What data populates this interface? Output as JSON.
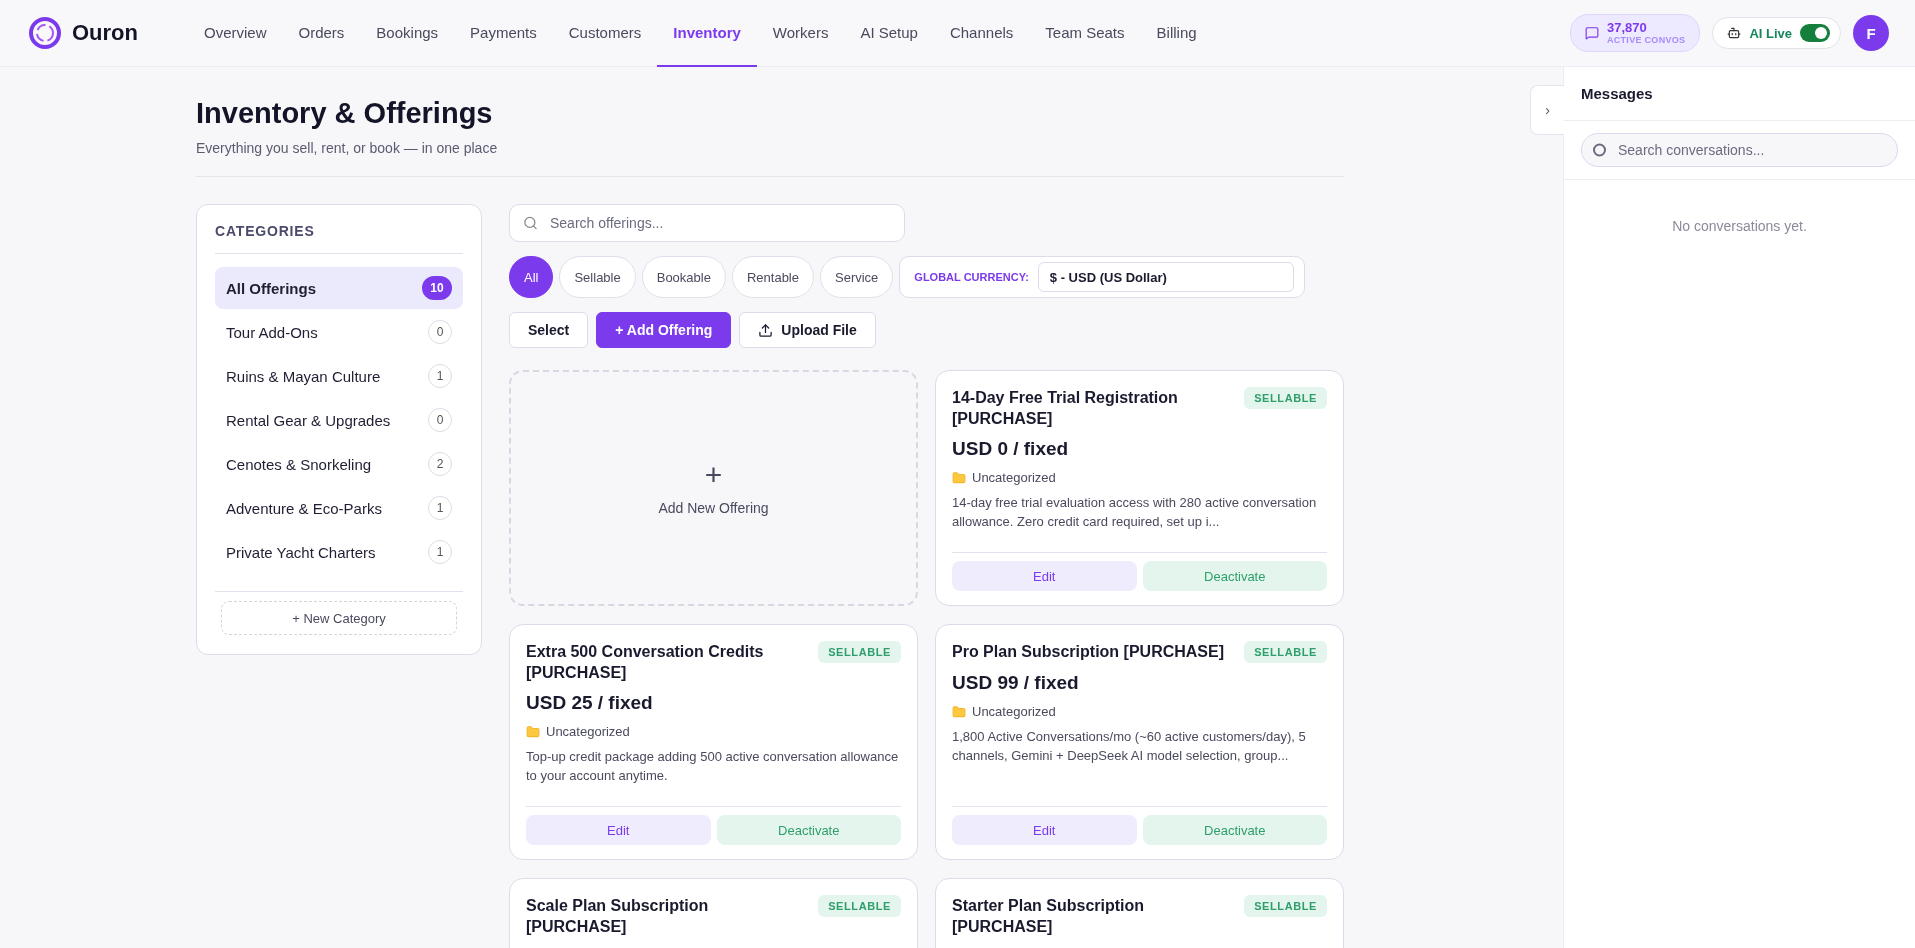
{
  "brand": {
    "name": "Ouron"
  },
  "nav": [
    {
      "label": "Overview",
      "selected": false
    },
    {
      "label": "Orders",
      "selected": false
    },
    {
      "label": "Bookings",
      "selected": false
    },
    {
      "label": "Payments",
      "selected": false
    },
    {
      "label": "Customers",
      "selected": false
    },
    {
      "label": "Inventory",
      "selected": true
    },
    {
      "label": "Workers",
      "selected": false
    },
    {
      "label": "AI Setup",
      "selected": false
    },
    {
      "label": "Channels",
      "selected": false
    },
    {
      "label": "Team Seats",
      "selected": false
    },
    {
      "label": "Billing",
      "selected": false
    }
  ],
  "convos": {
    "count": "37,870",
    "label": "ACTIVE CONVOS"
  },
  "ai_live": {
    "label": "AI Live",
    "on": true
  },
  "avatar": {
    "initial": "F"
  },
  "page": {
    "title": "Inventory & Offerings",
    "subtitle": "Everything you sell, rent, or book — in one place"
  },
  "categories": {
    "heading": "CATEGORIES",
    "items": [
      {
        "label": "All Offerings",
        "count": "10",
        "selected": true
      },
      {
        "label": "Tour Add-Ons",
        "count": "0",
        "selected": false
      },
      {
        "label": "Ruins & Mayan Culture",
        "count": "1",
        "selected": false
      },
      {
        "label": "Rental Gear & Upgrades",
        "count": "0",
        "selected": false
      },
      {
        "label": "Cenotes & Snorkeling",
        "count": "2",
        "selected": false
      },
      {
        "label": "Adventure & Eco-Parks",
        "count": "1",
        "selected": false
      },
      {
        "label": "Private Yacht Charters",
        "count": "1",
        "selected": false
      }
    ],
    "new_button": "+ New Category"
  },
  "search": {
    "placeholder": "Search offerings..."
  },
  "filters": [
    {
      "label": "All",
      "selected": true
    },
    {
      "label": "Sellable",
      "selected": false
    },
    {
      "label": "Bookable",
      "selected": false
    },
    {
      "label": "Rentable",
      "selected": false
    },
    {
      "label": "Service",
      "selected": false
    }
  ],
  "currency": {
    "label": "GLOBAL CURRENCY:",
    "value": "$ - USD (US Dollar)"
  },
  "actions": [
    {
      "label": "Select",
      "kind": "plain"
    },
    {
      "label": "+ Add Offering",
      "kind": "primary"
    },
    {
      "label": "Upload File",
      "kind": "upload"
    }
  ],
  "add_tile": {
    "label": "Add New Offering",
    "icon": "+"
  },
  "offerings": [
    {
      "title": "14-Day Free Trial Registration [PURCHASE]",
      "badge": "SELLABLE",
      "price": "USD 0 / fixed",
      "category": "Uncategorized",
      "description": "14-day free trial evaluation access with 280 active conversation allowance. Zero credit card required, set up i...",
      "edit": "Edit",
      "deactivate": "Deactivate"
    },
    {
      "title": "Extra 500 Conversation Credits [PURCHASE]",
      "badge": "SELLABLE",
      "price": "USD 25 / fixed",
      "category": "Uncategorized",
      "description": "Top-up credit package adding 500 active conversation allowance to your account anytime.",
      "edit": "Edit",
      "deactivate": "Deactivate"
    },
    {
      "title": "Pro Plan Subscription [PURCHASE]",
      "badge": "SELLABLE",
      "price": "USD 99 / fixed",
      "category": "Uncategorized",
      "description": "1,800 Active Conversations/mo (~60 active customers/day), 5 channels, Gemini + DeepSeek AI model selection, group...",
      "edit": "Edit",
      "deactivate": "Deactivate"
    },
    {
      "title": "Scale Plan Subscription [PURCHASE]",
      "badge": "SELLABLE"
    },
    {
      "title": "Starter Plan Subscription [PURCHASE]",
      "badge": "SELLABLE"
    }
  ],
  "messages": {
    "title": "Messages",
    "search_placeholder": "Search conversations...",
    "empty": "No conversations yet.",
    "toggle": "›"
  }
}
